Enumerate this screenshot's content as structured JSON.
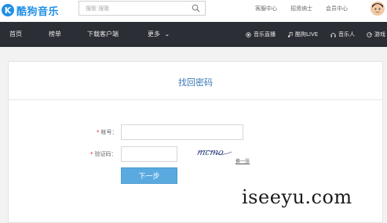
{
  "header": {
    "logo_mark": "K",
    "logo_text": "酷狗音乐",
    "search_placeholder": "搜歌 搜歌",
    "links": [
      "客服中心",
      "招贤纳士",
      "会员中心"
    ]
  },
  "nav": {
    "items": [
      "首页",
      "榜单",
      "下载客户端",
      "更多"
    ],
    "more_chevron": "⌄",
    "right_items": [
      {
        "label": "音乐直播",
        "icon": "broadcast-icon"
      },
      {
        "label": "酷狗LIVE",
        "icon": "music-note-icon"
      },
      {
        "label": "音乐人",
        "icon": "headphones-icon"
      },
      {
        "label": "游戏",
        "icon": "game-icon"
      }
    ]
  },
  "form": {
    "title": "找回密码",
    "account_label": "帐号：",
    "captcha_label": "验证码：",
    "required_mark": "*",
    "captcha_text": "mcmo",
    "refresh_label": "换一张",
    "submit_label": "下一步"
  },
  "watermark": "iseeyu.com",
  "colors": {
    "brand": "#1e8fe6",
    "navbar": "#2b2e35",
    "button": "#5aa9df",
    "title": "#3a78b5",
    "required": "#e02020"
  }
}
